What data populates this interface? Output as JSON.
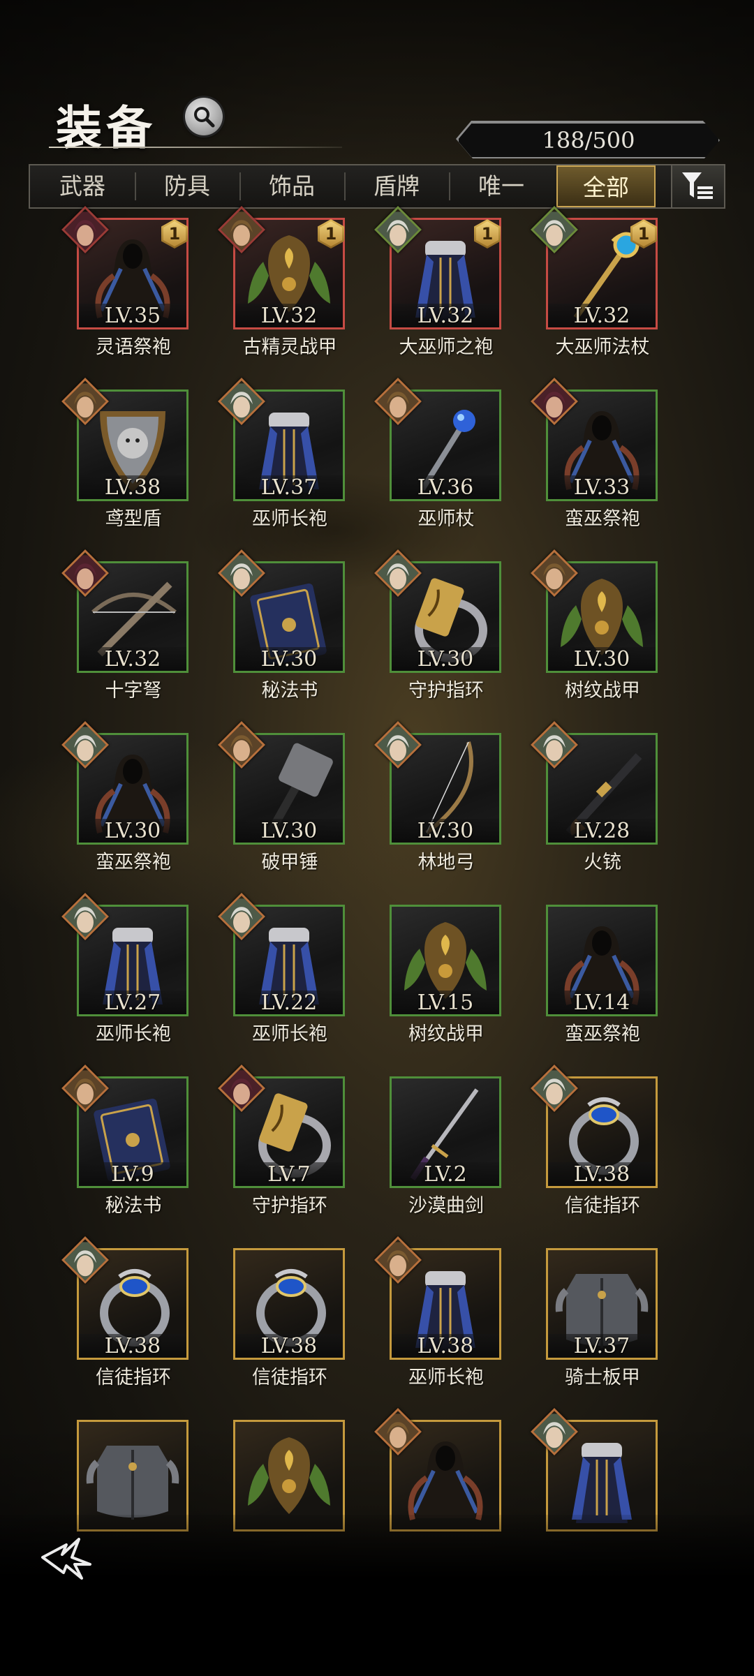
{
  "header": {
    "title": "装备",
    "count": "188/500"
  },
  "tabs": [
    {
      "label": "武器",
      "active": false
    },
    {
      "label": "防具",
      "active": false
    },
    {
      "label": "饰品",
      "active": false
    },
    {
      "label": "盾牌",
      "active": false
    },
    {
      "label": "唯一",
      "active": false
    },
    {
      "label": "全部",
      "active": true
    }
  ],
  "icons": {
    "search": "search-icon",
    "filter": "filter-icon",
    "back": "back-icon"
  },
  "colors": {
    "red_frame": "#c64b44",
    "green_frame": "#4f8f3a",
    "gold_frame": "#c59a3d",
    "badge": "#e3bb5a"
  },
  "items": [
    {
      "level": "LV.35",
      "name": "灵语祭袍",
      "rarity": "red",
      "badge": "1",
      "art": "robe-dark",
      "portrait": "red"
    },
    {
      "level": "LV.32",
      "name": "古精灵战甲",
      "rarity": "red",
      "badge": "1",
      "art": "armor-leaf",
      "portrait": "warm"
    },
    {
      "level": "LV.32",
      "name": "大巫师之袍",
      "rarity": "red",
      "badge": "1",
      "art": "robe-blue",
      "portrait": "cool"
    },
    {
      "level": "LV.32",
      "name": "大巫师法杖",
      "rarity": "red",
      "badge": "1",
      "art": "staff-gold",
      "portrait": "cool"
    },
    {
      "level": "LV.38",
      "name": "鸢型盾",
      "rarity": "green",
      "art": "shield",
      "portrait": "warm"
    },
    {
      "level": "LV.37",
      "name": "巫师长袍",
      "rarity": "green",
      "art": "robe-blue",
      "portrait": "cool"
    },
    {
      "level": "LV.36",
      "name": "巫师杖",
      "rarity": "green",
      "art": "staff-orb",
      "portrait": "warm"
    },
    {
      "level": "LV.33",
      "name": "蛮巫祭袍",
      "rarity": "green",
      "art": "robe-dark",
      "portrait": "red"
    },
    {
      "level": "LV.32",
      "name": "十字弩",
      "rarity": "green",
      "art": "crossbow",
      "portrait": "red"
    },
    {
      "level": "LV.30",
      "name": "秘法书",
      "rarity": "green",
      "art": "book",
      "portrait": "cool"
    },
    {
      "level": "LV.30",
      "name": "守护指环",
      "rarity": "green",
      "art": "ring-gold",
      "portrait": "cool"
    },
    {
      "level": "LV.30",
      "name": "树纹战甲",
      "rarity": "green",
      "art": "armor-leaf",
      "portrait": "warm"
    },
    {
      "level": "LV.30",
      "name": "蛮巫祭袍",
      "rarity": "green",
      "art": "robe-dark",
      "portrait": "cool"
    },
    {
      "level": "LV.30",
      "name": "破甲锤",
      "rarity": "green",
      "art": "hammer",
      "portrait": "warm"
    },
    {
      "level": "LV.30",
      "name": "林地弓",
      "rarity": "green",
      "art": "bow",
      "portrait": "cool"
    },
    {
      "level": "LV.28",
      "name": "火铳",
      "rarity": "green",
      "art": "gun",
      "portrait": "cool"
    },
    {
      "level": "LV.27",
      "name": "巫师长袍",
      "rarity": "green",
      "art": "robe-blue",
      "portrait": "cool"
    },
    {
      "level": "LV.22",
      "name": "巫师长袍",
      "rarity": "green",
      "art": "robe-blue",
      "portrait": "cool"
    },
    {
      "level": "LV.15",
      "name": "树纹战甲",
      "rarity": "green",
      "art": "armor-leaf",
      "portrait": ""
    },
    {
      "level": "LV.14",
      "name": "蛮巫祭袍",
      "rarity": "green",
      "art": "robe-dark",
      "portrait": ""
    },
    {
      "level": "LV.9",
      "name": "秘法书",
      "rarity": "green",
      "art": "book",
      "portrait": "warm"
    },
    {
      "level": "LV.7",
      "name": "守护指环",
      "rarity": "green",
      "art": "ring-gold",
      "portrait": "red"
    },
    {
      "level": "LV.2",
      "name": "沙漠曲剑",
      "rarity": "green",
      "art": "sword",
      "portrait": ""
    },
    {
      "level": "LV.38",
      "name": "信徒指环",
      "rarity": "gold",
      "art": "ring-blue",
      "portrait": "cool"
    },
    {
      "level": "LV.38",
      "name": "信徒指环",
      "rarity": "gold",
      "art": "ring-blue",
      "portrait": "cool"
    },
    {
      "level": "LV.38",
      "name": "信徒指环",
      "rarity": "gold",
      "art": "ring-blue",
      "portrait": ""
    },
    {
      "level": "LV.38",
      "name": "巫师长袍",
      "rarity": "gold",
      "art": "robe-blue",
      "portrait": "warm"
    },
    {
      "level": "LV.37",
      "name": "骑士板甲",
      "rarity": "gold",
      "art": "plate",
      "portrait": ""
    },
    {
      "level": "",
      "name": "",
      "rarity": "gold",
      "art": "plate",
      "portrait": ""
    },
    {
      "level": "",
      "name": "",
      "rarity": "gold",
      "art": "armor-leaf",
      "portrait": ""
    },
    {
      "level": "",
      "name": "",
      "rarity": "gold",
      "art": "robe-dark",
      "portrait": "warm"
    },
    {
      "level": "",
      "name": "",
      "rarity": "gold",
      "art": "robe-blue",
      "portrait": "cool"
    }
  ]
}
